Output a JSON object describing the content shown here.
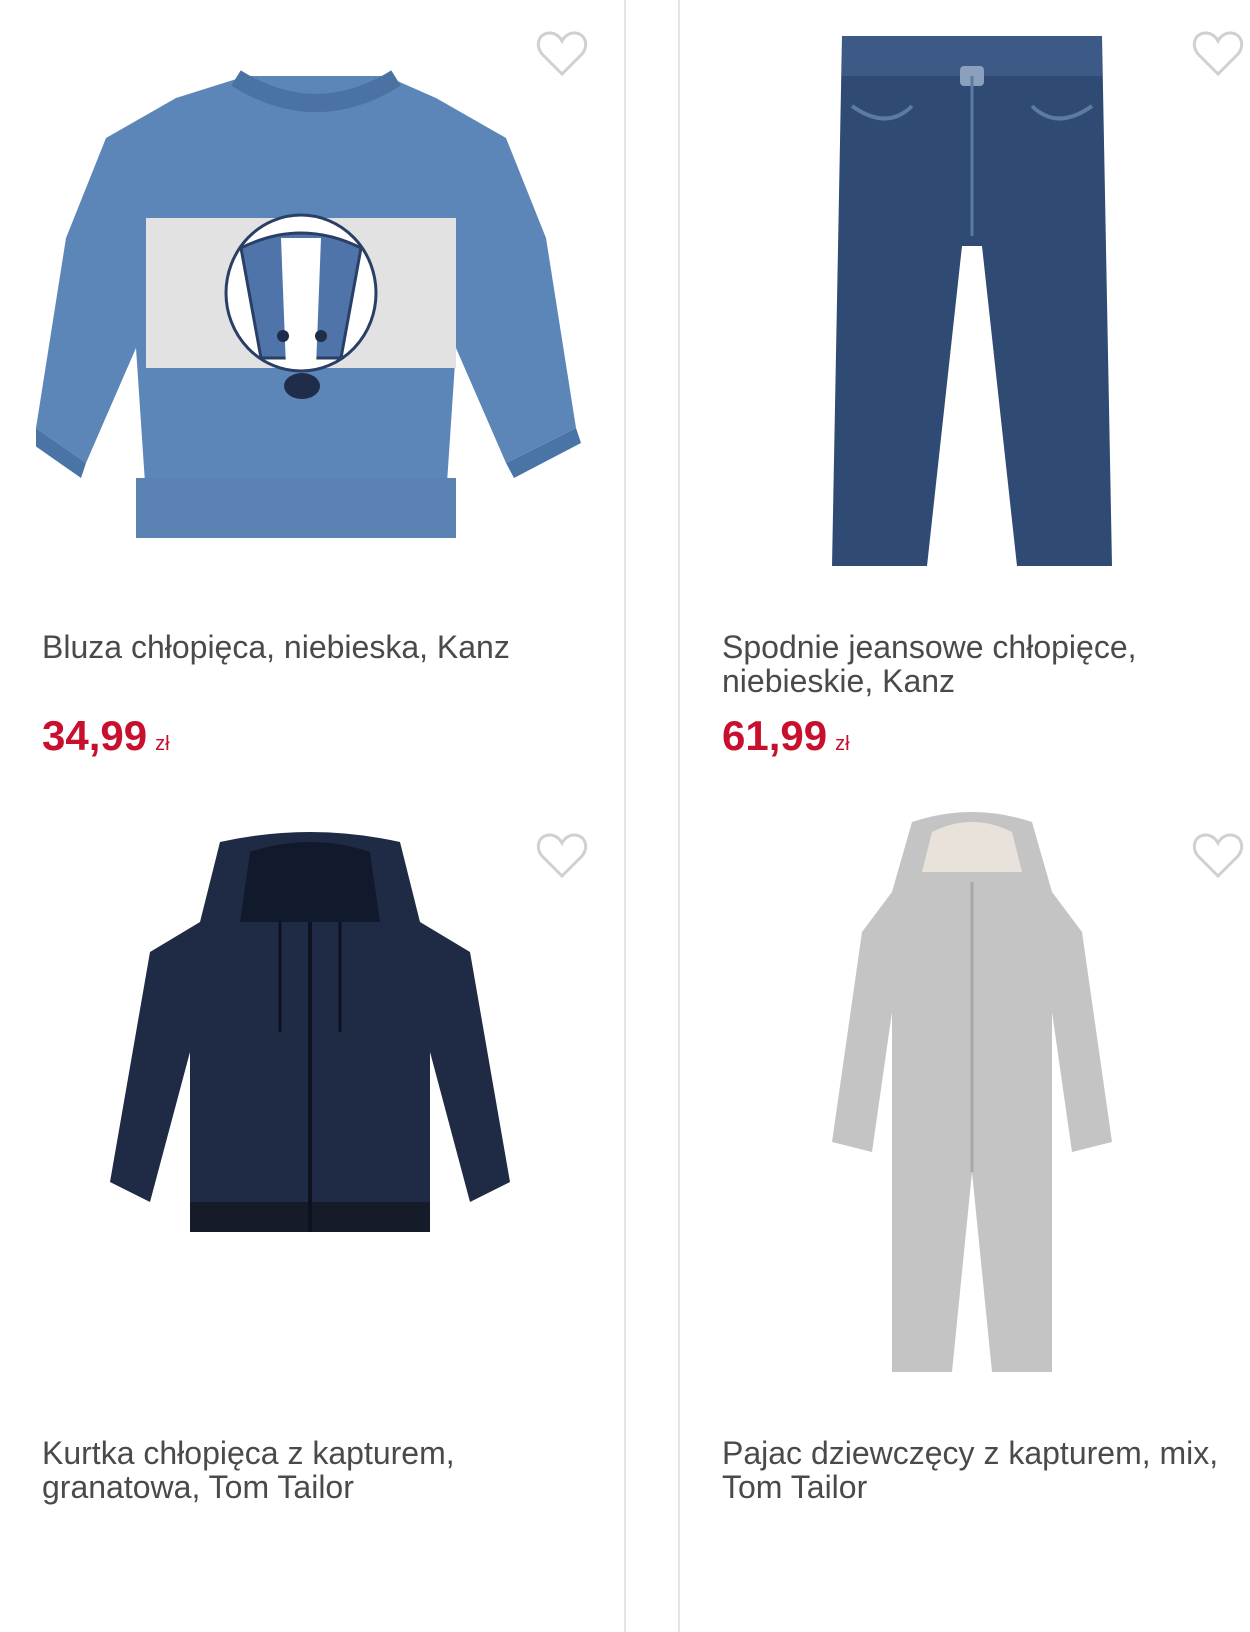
{
  "products": [
    {
      "title": "Bluza chłopięca, niebieska, Kanz",
      "price": "34,99",
      "currency": "zł",
      "image_icon": "sweatshirt-badger-icon",
      "favorite_icon": "heart-outline-icon"
    },
    {
      "title": "Spodnie jeansowe chłopięce, niebieskie, Kanz",
      "price": "61,99",
      "currency": "zł",
      "image_icon": "jeans-icon",
      "favorite_icon": "heart-outline-icon"
    },
    {
      "title": "Kurtka chłopięca z kapturem, granatowa, Tom Tailor",
      "price": "",
      "currency": "",
      "image_icon": "hooded-jacket-icon",
      "favorite_icon": "heart-outline-icon"
    },
    {
      "title": "Pajac dziewczęcy z kapturem, mix, Tom Tailor",
      "price": "",
      "currency": "",
      "image_icon": "hooded-onesie-icon",
      "favorite_icon": "heart-outline-icon"
    }
  ],
  "colors": {
    "price": "#c8102e",
    "text": "#4a4a4a",
    "border": "#e4e4e4",
    "heart": "#d0d0d0"
  }
}
